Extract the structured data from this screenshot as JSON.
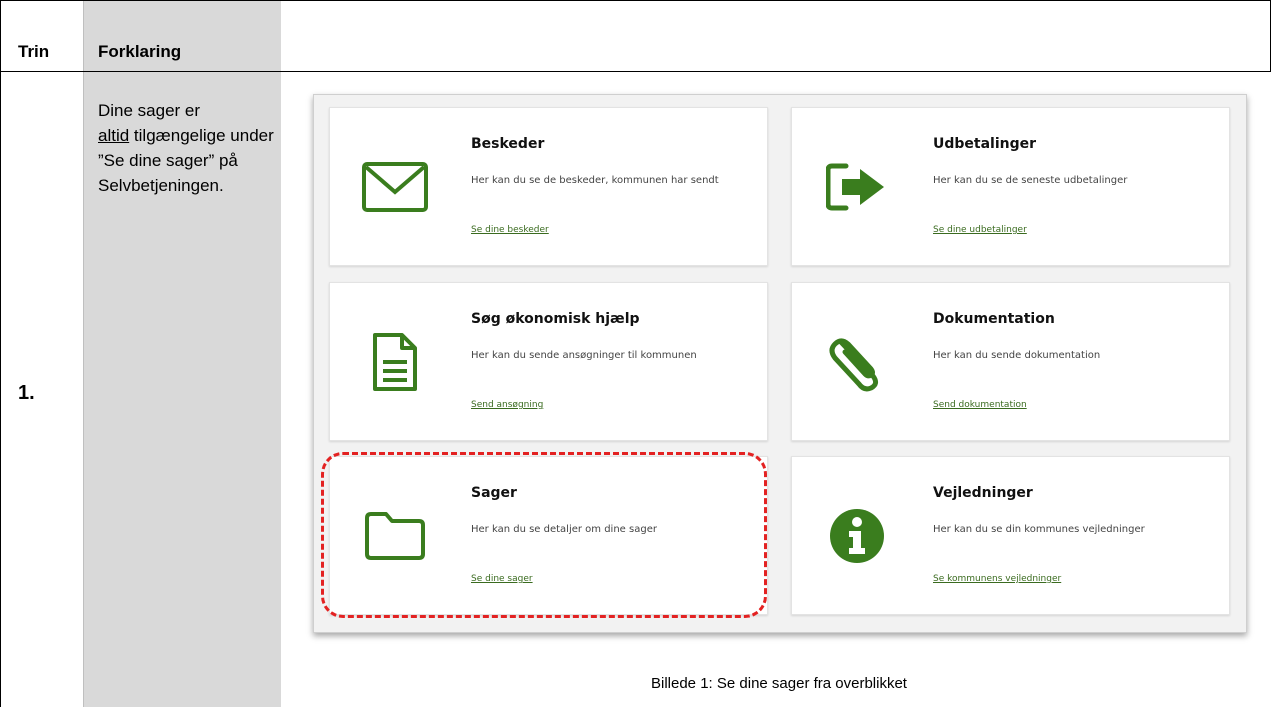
{
  "header": {
    "col1": "Trin",
    "col2": "Forklaring"
  },
  "step": {
    "number": "1.",
    "explanation_pre": "Dine sager er",
    "explanation_underlined": "altid",
    "explanation_post": " tilgængelige under ”Se dine sager” på Selvbetjeningen."
  },
  "cards": [
    {
      "title": "Beskeder",
      "desc": "Her kan du se de beskeder, kommunen har sendt",
      "link": "Se dine beskeder",
      "icon": "envelope-icon"
    },
    {
      "title": "Udbetalinger",
      "desc": "Her kan du se de seneste udbetalinger",
      "link": "Se dine udbetalinger",
      "icon": "exit-arrow-icon"
    },
    {
      "title": "Søg økonomisk hjælp",
      "desc": "Her kan du sende ansøgninger til kommunen",
      "link": "Send ansøgning",
      "icon": "document-icon"
    },
    {
      "title": "Dokumentation",
      "desc": "Her kan du sende dokumentation",
      "link": "Send dokumentation",
      "icon": "paperclip-icon"
    },
    {
      "title": "Sager",
      "desc": "Her kan du se detaljer om dine sager",
      "link": "Se dine sager",
      "icon": "folder-icon"
    },
    {
      "title": "Vejledninger",
      "desc": "Her kan du se din kommunes vejledninger",
      "link": "Se kommunens vejledninger",
      "icon": "info-icon"
    }
  ],
  "caption": "Billede 1: Se dine sager fra overblikket",
  "colors": {
    "accent_green": "#3a7d1e",
    "highlight_red": "#e32222",
    "column_gray": "#d9d9d9"
  }
}
